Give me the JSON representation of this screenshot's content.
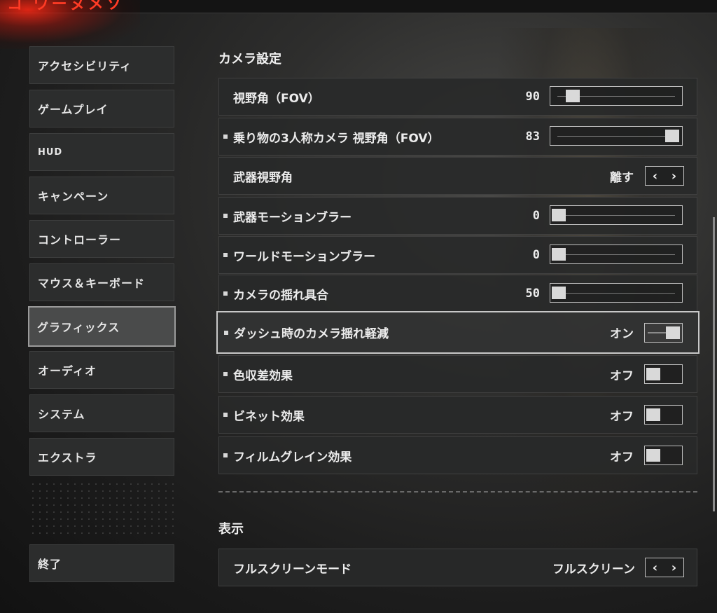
{
  "header": {
    "logo_text": "コ ワーヌメソ"
  },
  "sidebar": {
    "items": [
      {
        "label": "アクセシビリティ",
        "active": false
      },
      {
        "label": "ゲームプレイ",
        "active": false
      },
      {
        "label": "HUD",
        "active": false
      },
      {
        "label": "キャンペーン",
        "active": false
      },
      {
        "label": "コントローラー",
        "active": false
      },
      {
        "label": "マウス＆キーボード",
        "active": false
      },
      {
        "label": "グラフィックス",
        "active": true
      },
      {
        "label": "オーディオ",
        "active": false
      },
      {
        "label": "システム",
        "active": false
      },
      {
        "label": "エクストラ",
        "active": false
      }
    ],
    "exit_label": "終了"
  },
  "camera": {
    "title": "カメラ設定",
    "settings": [
      {
        "label": "視野角（FOV）",
        "bullet": false,
        "type": "slider",
        "value": "90",
        "level": 0.0
      },
      {
        "label": "乗り物の3人称カメラ 視野角（FOV）",
        "bullet": true,
        "type": "slider",
        "value": "83",
        "level": 1.0
      },
      {
        "label": "武器視野角",
        "bullet": false,
        "type": "select",
        "value": "離す"
      },
      {
        "label": "武器モーションブラー",
        "bullet": true,
        "type": "slider",
        "value": "0",
        "level": 0.0
      },
      {
        "label": "ワールドモーションブラー",
        "bullet": true,
        "type": "slider",
        "value": "0",
        "level": 0.0
      },
      {
        "label": "カメラの揺れ具合",
        "bullet": true,
        "type": "slider",
        "value": "50",
        "level": 0.0
      },
      {
        "label": "ダッシュ時のカメラ揺れ軽減",
        "bullet": true,
        "type": "toggle",
        "value": "オン",
        "on": true
      },
      {
        "label": "色収差効果",
        "bullet": true,
        "type": "toggle",
        "value": "オフ",
        "on": false
      },
      {
        "label": "ビネット効果",
        "bullet": true,
        "type": "toggle",
        "value": "オフ",
        "on": false
      },
      {
        "label": "フィルムグレイン効果",
        "bullet": true,
        "type": "toggle",
        "value": "オフ",
        "on": false
      }
    ]
  },
  "display": {
    "title": "表示",
    "settings": [
      {
        "label": "フルスクリーンモード",
        "type": "select",
        "value": "フルスクリーン"
      }
    ]
  },
  "icons": {
    "left": "‹",
    "right": "›"
  }
}
